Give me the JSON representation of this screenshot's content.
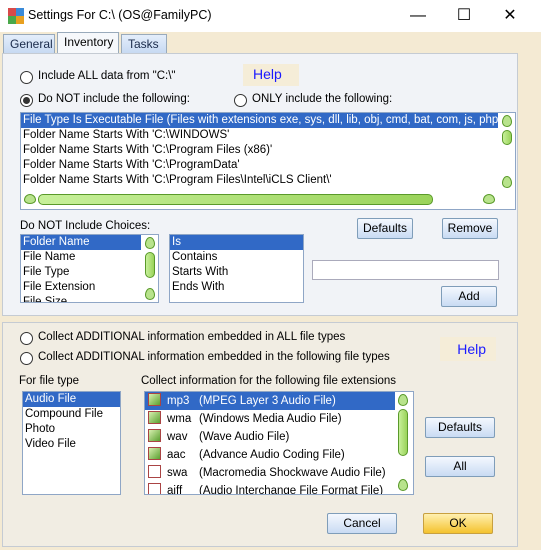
{
  "window": {
    "title": "Settings For C:\\ (OS@FamilyPC)",
    "minimize": "—",
    "maximize": "☐",
    "close": "✕"
  },
  "tabs": [
    {
      "label": "General"
    },
    {
      "label": "Inventory",
      "active": true
    },
    {
      "label": "Tasks"
    }
  ],
  "inventory": {
    "include_all_label": "Include ALL data from \"C:\\\"",
    "do_not_label": "Do NOT include the following:",
    "only_label": "ONLY include the following:",
    "selected_mode": "do_not",
    "help": "Help",
    "rules": [
      "File Type Is Executable File (Files with extensions exe, sys, dll, lib, obj, cmd, bat, com, js, php, pl, p",
      "Folder Name Starts With 'C:\\WINDOWS'",
      "Folder Name Starts With 'C:\\Program Files (x86)'",
      "Folder Name Starts With 'C:\\ProgramData'",
      "Folder Name Starts With 'C:\\Program Files\\Intel\\iCLS Client\\'"
    ],
    "choices_label": "Do NOT Include Choices:",
    "fields": [
      "Folder Name",
      "File Name",
      "File Type",
      "File Extension",
      "File Size"
    ],
    "operators": [
      "Is",
      "Contains",
      "Starts With",
      "Ends With"
    ],
    "value_input": "",
    "defaults_button": "Defaults",
    "remove_button": "Remove",
    "add_button": "Add"
  },
  "additional": {
    "all_label": "Collect ADDITIONAL information embedded in ALL file types",
    "following_label": "Collect ADDITIONAL information embedded in the following file types",
    "help": "Help",
    "for_file_type_label": "For file type",
    "extensions_label": "Collect information for the following file extensions",
    "file_types": [
      "Audio File",
      "Compound File",
      "Photo",
      "Video File"
    ],
    "extensions": [
      {
        "ext": "mp3",
        "desc": "(MPEG Layer 3 Audio File)",
        "checked": true
      },
      {
        "ext": "wma",
        "desc": "(Windows Media Audio File)",
        "checked": true
      },
      {
        "ext": "wav",
        "desc": "(Wave Audio File)",
        "checked": true
      },
      {
        "ext": "aac",
        "desc": "(Advance Audio Coding File)",
        "checked": true
      },
      {
        "ext": "swa",
        "desc": "(Macromedia Shockwave Audio File)",
        "checked": false
      },
      {
        "ext": "aiff",
        "desc": "(Audio Interchange File Format File)",
        "checked": false
      }
    ],
    "defaults_button": "Defaults",
    "all_button": "All"
  },
  "footer": {
    "cancel": "Cancel",
    "ok": "OK"
  },
  "colors": {
    "selection": "#3169c6",
    "help_link": "#1a1aff",
    "ok_button": "#f4c22e"
  }
}
